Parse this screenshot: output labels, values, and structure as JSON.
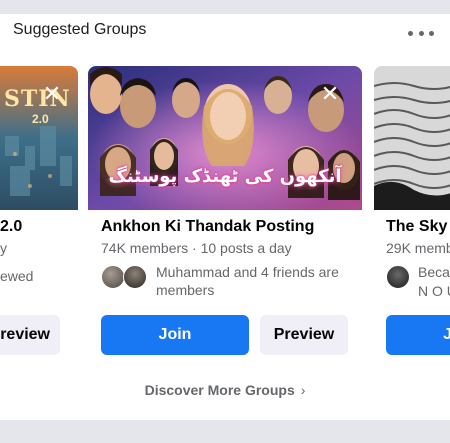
{
  "header": {
    "title": "Suggested Groups"
  },
  "cards": [
    {
      "image_text": "STIN",
      "image_subtext": "2.0",
      "name": "2.0",
      "meta": "y",
      "friends_text": "ewed",
      "preview_label": "review"
    },
    {
      "image_text": "آنکھوں کی ٹھنڈک پوسٹنگ",
      "name": "Ankhon Ki Thandak Posting",
      "meta": "74K members · 10 posts a day",
      "friends_text": "Muhammad and 4 friends are members",
      "join_label": "Join",
      "preview_label": "Preview"
    },
    {
      "name": "The Sky",
      "meta": "29K memb",
      "friends_text": "Beca",
      "friends_text_2": "N O U",
      "join_label": "J"
    }
  ],
  "footer": {
    "discover_label": "Discover More Groups"
  },
  "colors": {
    "join_blue": "#1877f2",
    "preview_bg": "#f0eff7",
    "muted_text": "#65676b"
  }
}
